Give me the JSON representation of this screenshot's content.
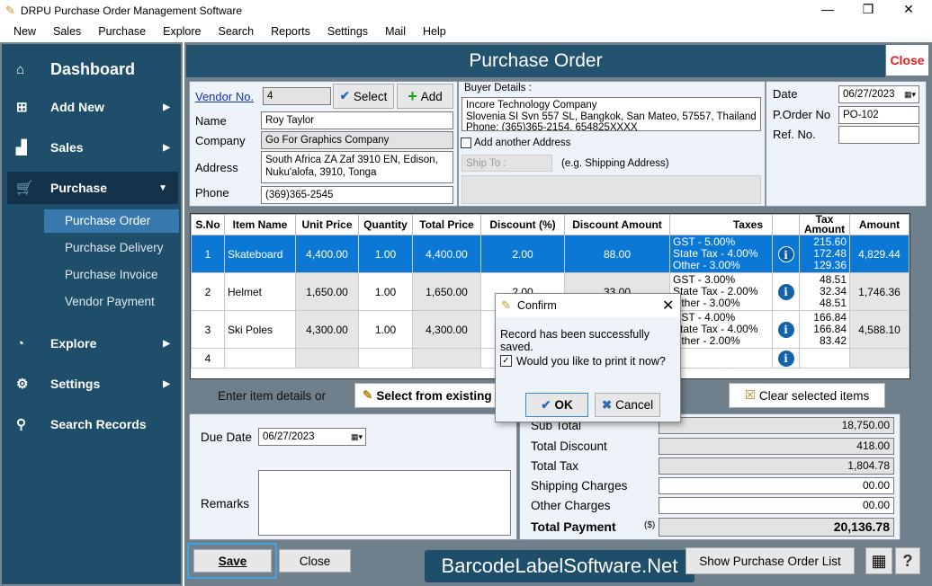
{
  "window": {
    "title": "DRPU Purchase Order Management Software",
    "minimize": "—",
    "maximize": "❐",
    "close": "✕"
  },
  "menu": [
    "New",
    "Sales",
    "Purchase",
    "Explore",
    "Search",
    "Reports",
    "Settings",
    "Mail",
    "Help"
  ],
  "sidebar": {
    "items": [
      {
        "label": "Dashboard",
        "icon": "home-icon"
      },
      {
        "label": "Add New",
        "icon": "add-icon"
      },
      {
        "label": "Sales",
        "icon": "chart-icon"
      },
      {
        "label": "Purchase",
        "icon": "cart-icon"
      },
      {
        "label": "Explore",
        "icon": "explore-icon"
      },
      {
        "label": "Settings",
        "icon": "gear-icon"
      },
      {
        "label": "Search Records",
        "icon": "search-icon"
      }
    ],
    "purchase_sub": [
      "Purchase Order",
      "Purchase Delivery",
      "Purchase Invoice",
      "Vendor Payment"
    ]
  },
  "header": {
    "title": "Purchase Order",
    "close": "Close"
  },
  "vendor": {
    "vendor_no_label": "Vendor No.",
    "vendor_no": "4",
    "select": "Select",
    "add": "Add",
    "name_label": "Name",
    "name": "Roy Taylor",
    "company_label": "Company",
    "company": "Go For Graphics Company",
    "address_label": "Address",
    "address1": "South Africa ZA Zaf 3910 EN, Edison,",
    "address2": "Nuku'alofa, 3910, Tonga",
    "phone_label": "Phone",
    "phone": "(369)365-2545"
  },
  "buyer": {
    "label": "Buyer Details :",
    "line1": "Incore Technology Company",
    "line2": "Slovenia SI Svn 557 SL, Bangkok, San Mateo, 57557, Thailand",
    "line3": "Phone: (365)365-2154, 654825XXXX",
    "add_another": "Add another Address",
    "add_another_checked": false,
    "ship_to_placeholder": "Ship To :",
    "ship_hint": "(e.g. Shipping Address)"
  },
  "order": {
    "date_label": "Date",
    "date": "06/27/2023",
    "po_label": "P.Order No",
    "po": "PO-102",
    "ref_label": "Ref. No.",
    "ref": ""
  },
  "grid": {
    "headers": [
      "S.No",
      "Item Name",
      "Unit Price",
      "Quantity",
      "Total Price",
      "Discount (%)",
      "Discount Amount",
      "Taxes",
      "",
      "Tax Amount",
      "Amount"
    ],
    "rows": [
      {
        "sno": "1",
        "item": "Skateboard",
        "unit": "4,400.00",
        "qty": "1.00",
        "total": "4,400.00",
        "disc_pct": "2.00",
        "disc_amt": "88.00",
        "taxes": [
          "GST - 5.00%",
          "State Tax - 4.00%",
          "Other - 3.00%"
        ],
        "tax_amt": [
          "215.60",
          "172.48",
          "129.36"
        ],
        "amount": "4,829.44",
        "selected": true
      },
      {
        "sno": "2",
        "item": "Helmet",
        "unit": "1,650.00",
        "qty": "1.00",
        "total": "1,650.00",
        "disc_pct": "2.00",
        "disc_amt": "33.00",
        "taxes": [
          "GST - 3.00%",
          "State Tax - 2.00%",
          "Other - 3.00%"
        ],
        "tax_amt": [
          "48.51",
          "32.34",
          "48.51"
        ],
        "amount": "1,746.36"
      },
      {
        "sno": "3",
        "item": "Ski Poles",
        "unit": "4,300.00",
        "qty": "1.00",
        "total": "4,300.00",
        "disc_pct": "",
        "disc_amt": "",
        "taxes": [
          "GST - 4.00%",
          "State Tax - 4.00%",
          "Other - 2.00%"
        ],
        "tax_amt": [
          "166.84",
          "166.84",
          "83.42"
        ],
        "amount": "4,588.10"
      },
      {
        "sno": "4"
      }
    ]
  },
  "items_bar": {
    "label": "Enter item details or",
    "select_existing": "Select from existing",
    "clear": "Clear selected items"
  },
  "bottom": {
    "due_label": "Due Date",
    "due": "06/27/2023",
    "remarks_label": "Remarks",
    "remarks": ""
  },
  "summary": {
    "sub_total_label": "Sub Total",
    "sub_total": "18,750.00",
    "discount_label": "Total Discount",
    "discount": "418.00",
    "tax_label": "Total Tax",
    "tax": "1,804.78",
    "shipping_label": "Shipping Charges",
    "shipping": "00.00",
    "other_label": "Other Charges",
    "other": "00.00",
    "payment_label": "Total Payment",
    "currency": "($)",
    "payment": "20,136.78"
  },
  "footer": {
    "save": "Save",
    "close": "Close",
    "watermark": "BarcodeLabelSoftware.Net",
    "show_list": "Show Purchase Order List",
    "help": "?"
  },
  "dialog": {
    "title": "Confirm",
    "message": "Record has been successfully saved.",
    "print_q": "Would you like to print it now?",
    "print_checked": true,
    "ok": "OK",
    "cancel": "Cancel"
  }
}
